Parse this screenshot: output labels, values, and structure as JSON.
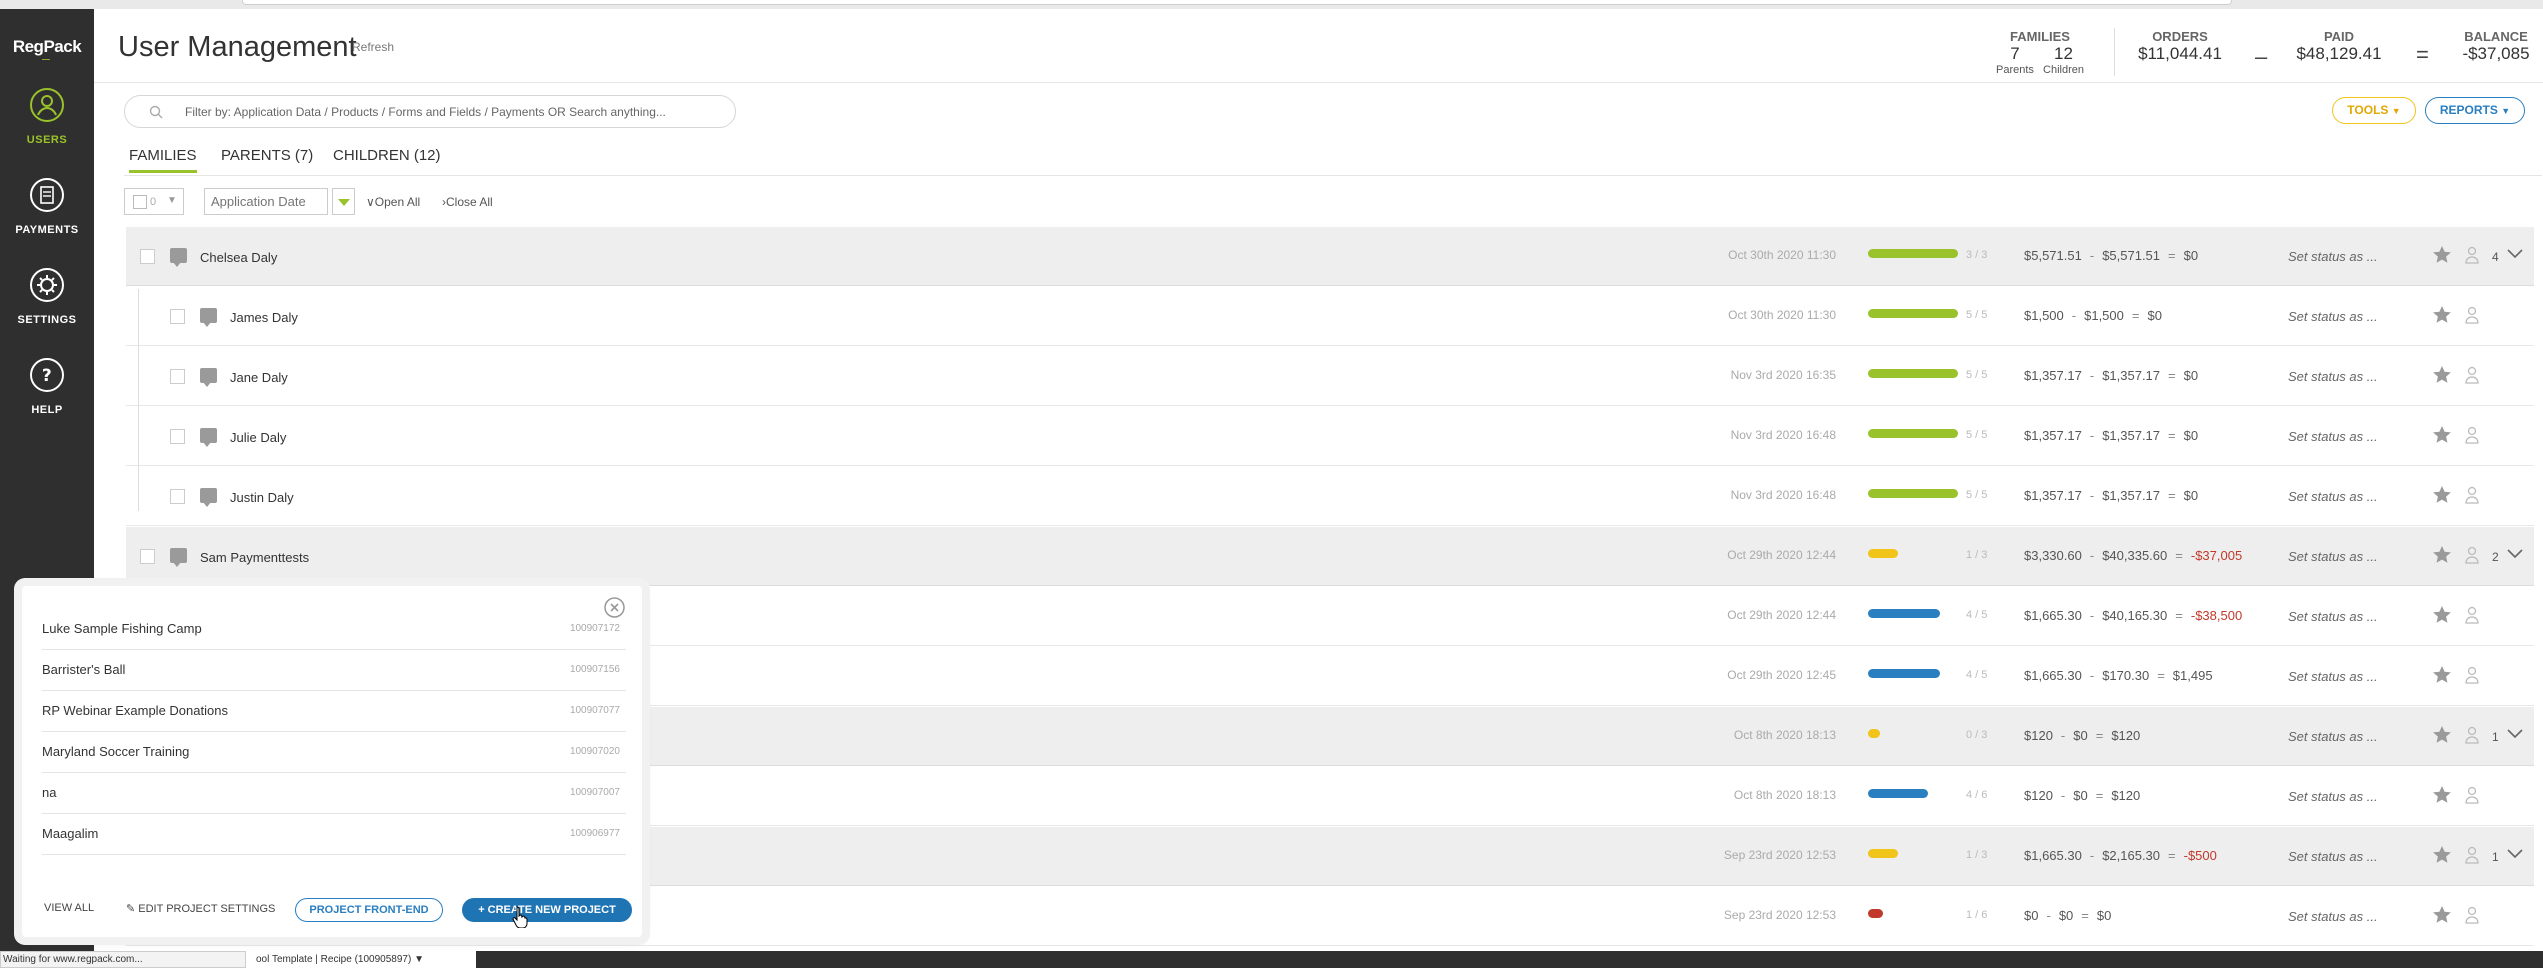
{
  "app": {
    "logo": "RegPack"
  },
  "sidebar": {
    "items": [
      {
        "label": "USERS",
        "icon": "user-circle-icon",
        "active": true
      },
      {
        "label": "PAYMENTS",
        "icon": "receipt-icon",
        "active": false
      },
      {
        "label": "SETTINGS",
        "icon": "gear-icon",
        "active": false
      },
      {
        "label": "HELP",
        "icon": "question-icon",
        "active": false
      }
    ]
  },
  "header": {
    "title": "User Management",
    "refresh": "Refresh",
    "families": {
      "label": "FAMILIES",
      "parents_value": "7",
      "parents_label": "Parents",
      "children_value": "12",
      "children_label": "Children"
    },
    "orders": {
      "label": "ORDERS",
      "value": "$11,044.41"
    },
    "minus": "–",
    "paid": {
      "label": "PAID",
      "value": "$48,129.41"
    },
    "equals": "=",
    "balance": {
      "label": "BALANCE",
      "value": "-$37,085"
    }
  },
  "search": {
    "placeholder": "Filter by: Application Data / Products / Forms and Fields / Payments OR Search anything..."
  },
  "toolbar": {
    "tools_label": "TOOLS",
    "reports_label": "REPORTS"
  },
  "tabs": [
    {
      "label": "FAMILIES",
      "active": true
    },
    {
      "label": "PARENTS (7)",
      "active": false
    },
    {
      "label": "CHILDREN (12)",
      "active": false
    }
  ],
  "filters": {
    "selected_count": "0",
    "sort_placeholder": "Application Date",
    "open_all": "Open All",
    "close_all": "Close All"
  },
  "rows": [
    {
      "type": "parent",
      "name": "Chelsea Daly",
      "date": "Oct 30th 2020 11:30",
      "progress": 1.0,
      "bar_color": "#9ac22b",
      "count": "3 / 3",
      "orders": "$5,571.51",
      "paid": "$5,571.51",
      "balance": "$0",
      "negative": false,
      "status": "Set status as ...",
      "kids": "4"
    },
    {
      "type": "child",
      "name": "James Daly",
      "date": "Oct 30th 2020 11:30",
      "progress": 1.0,
      "bar_color": "#9ac22b",
      "count": "5 / 5",
      "orders": "$1,500",
      "paid": "$1,500",
      "balance": "$0",
      "negative": false,
      "status": "Set status as ..."
    },
    {
      "type": "child",
      "name": "Jane Daly",
      "date": "Nov 3rd 2020 16:35",
      "progress": 1.0,
      "bar_color": "#9ac22b",
      "count": "5 / 5",
      "orders": "$1,357.17",
      "paid": "$1,357.17",
      "balance": "$0",
      "negative": false,
      "status": "Set status as ..."
    },
    {
      "type": "child",
      "name": "Julie Daly",
      "date": "Nov 3rd 2020 16:48",
      "progress": 1.0,
      "bar_color": "#9ac22b",
      "count": "5 / 5",
      "orders": "$1,357.17",
      "paid": "$1,357.17",
      "balance": "$0",
      "negative": false,
      "status": "Set status as ..."
    },
    {
      "type": "child",
      "name": "Justin Daly",
      "date": "Nov 3rd 2020 16:48",
      "progress": 1.0,
      "bar_color": "#9ac22b",
      "count": "5 / 5",
      "orders": "$1,357.17",
      "paid": "$1,357.17",
      "balance": "$0",
      "negative": false,
      "status": "Set status as ..."
    },
    {
      "type": "parent",
      "name": "Sam Paymenttests",
      "date": "Oct 29th 2020 12:44",
      "progress": 0.33,
      "bar_color": "#f0c419",
      "count": "1 / 3",
      "orders": "$3,330.60",
      "paid": "$40,335.60",
      "balance": "-$37,005",
      "negative": true,
      "status": "Set status as ...",
      "kids": "2"
    },
    {
      "type": "child",
      "name": "",
      "date": "Oct 29th 2020 12:44",
      "progress": 0.8,
      "bar_color": "#2a7fc0",
      "count": "4 / 5",
      "orders": "$1,665.30",
      "paid": "$40,165.30",
      "balance": "-$38,500",
      "negative": true,
      "status": "Set status as ..."
    },
    {
      "type": "child",
      "name": "",
      "date": "Oct 29th 2020 12:45",
      "progress": 0.8,
      "bar_color": "#2a7fc0",
      "count": "4 / 5",
      "orders": "$1,665.30",
      "paid": "$170.30",
      "balance": "$1,495",
      "negative": false,
      "status": "Set status as ..."
    },
    {
      "type": "parent",
      "name": "",
      "date": "Oct 8th 2020 18:13",
      "progress": 0.0,
      "bar_color": "#f0c419",
      "count": "0 / 3",
      "orders": "$120",
      "paid": "$0",
      "balance": "$120",
      "negative": false,
      "status": "Set status as ...",
      "kids": "1"
    },
    {
      "type": "child",
      "name": "",
      "date": "Oct 8th 2020 18:13",
      "progress": 0.67,
      "bar_color": "#2a7fc0",
      "count": "4 / 6",
      "orders": "$120",
      "paid": "$0",
      "balance": "$120",
      "negative": false,
      "status": "Set status as ..."
    },
    {
      "type": "parent",
      "name": "",
      "date": "Sep 23rd 2020 12:53",
      "progress": 0.33,
      "bar_color": "#f0c419",
      "count": "1 / 3",
      "orders": "$1,665.30",
      "paid": "$2,165.30",
      "balance": "-$500",
      "negative": true,
      "status": "Set status as ...",
      "kids": "1"
    },
    {
      "type": "child",
      "name": "",
      "date": "Sep 23rd 2020 12:53",
      "progress": 0.17,
      "bar_color": "#c0392b",
      "count": "1 / 6",
      "orders": "$0",
      "paid": "$0",
      "balance": "$0",
      "negative": false,
      "status": "Set status as ..."
    }
  ],
  "money_ops": {
    "minus": "-",
    "equals": "="
  },
  "popup": {
    "projects": [
      {
        "name": "Luke Sample Fishing Camp",
        "id": "100907172"
      },
      {
        "name": "Barrister's Ball",
        "id": "100907156"
      },
      {
        "name": "RP Webinar Example Donations",
        "id": "100907077"
      },
      {
        "name": "Maryland Soccer Training",
        "id": "100907020"
      },
      {
        "name": "na",
        "id": "100907007"
      },
      {
        "name": "Maagalim",
        "id": "100906977"
      }
    ],
    "view_all": "VIEW ALL",
    "edit_settings": "EDIT PROJECT SETTINGS",
    "front_end": "PROJECT FRONT-END",
    "create_new": "+ CREATE NEW PROJECT"
  },
  "statusbar": {
    "loading_text": "Waiting for www.regpack.com...",
    "project_selector": "ool Template | Recipe (100905897)"
  }
}
